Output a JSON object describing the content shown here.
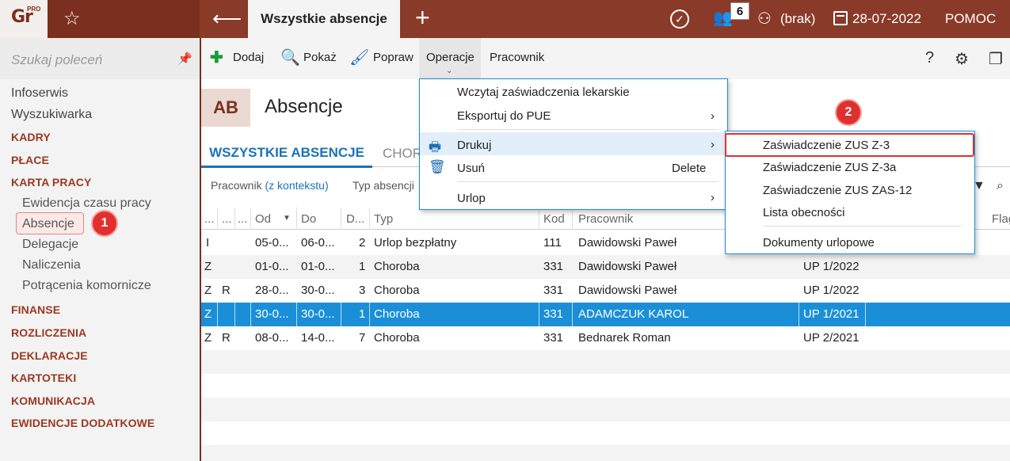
{
  "app": {
    "logo": "Gr",
    "logo_sup": "PRO",
    "active_tab": "Wszystkie absencje",
    "notif_count": "6",
    "user": "(brak)",
    "date": "28-07-2022",
    "help": "POMOC"
  },
  "sidebar": {
    "search_placeholder": "Szukaj poleceń",
    "items": [
      "Infoserwis",
      "Wyszukiwarka"
    ],
    "sections": [
      "KADRY",
      "PŁACE",
      "KARTA PRACY"
    ],
    "karta_sub": [
      "Ewidencja czasu pracy",
      "Absencje",
      "Delegacje",
      "Naliczenia",
      "Potrącenia komornicze"
    ],
    "sections2": [
      "FINANSE",
      "ROZLICZENIA",
      "DEKLARACJE",
      "KARTOTEKI",
      "KOMUNIKACJA",
      "EWIDENCJE DODATKOWE"
    ]
  },
  "toolbar": {
    "add": "Dodaj",
    "show": "Pokaż",
    "edit": "Popraw",
    "operations": "Operacje",
    "employee": "Pracownik",
    "help_icon": "?"
  },
  "header": {
    "badge": "AB",
    "title": "Absencje",
    "tab_all": "WSZYSTKIE ABSENCJE",
    "tab_sick": "CHOR",
    "filter_employee": "Pracownik",
    "filter_context": "(z kontekstu)",
    "filter_type": "Typ absencji"
  },
  "table": {
    "columns": [
      "...",
      "...",
      "...",
      "Od",
      "Do",
      "D...",
      "Typ",
      "Kod",
      "Pracownik",
      "Flag"
    ],
    "rows": [
      [
        "I",
        "",
        "",
        "05-0...",
        "06-0...",
        "2",
        "Urlop bezpłatny",
        "111",
        "Dawidowski Paweł",
        ""
      ],
      [
        "Z",
        "",
        "",
        "01-0...",
        "01-0...",
        "1",
        "Choroba",
        "331",
        "Dawidowski Paweł",
        "UP 1/2022"
      ],
      [
        "Z",
        "R",
        "",
        "28-0...",
        "30-0...",
        "3",
        "Choroba",
        "331",
        "Dawidowski Paweł",
        "UP 1/2022"
      ],
      [
        "Z",
        "",
        "",
        "30-0...",
        "30-0...",
        "1",
        "Choroba",
        "331",
        "ADAMCZUK KAROL",
        "UP 1/2021"
      ],
      [
        "Z",
        "R",
        "",
        "08-0...",
        "14-0...",
        "7",
        "Choroba",
        "331",
        "Bednarek Roman",
        "UP 2/2021"
      ]
    ],
    "selected_row": 3
  },
  "menu": {
    "items": [
      "Wczytaj zaświadczenia lekarskie",
      "Eksportuj do PUE",
      "Drukuj",
      "Usuń",
      "Urlop"
    ],
    "delete_shortcut": "Delete",
    "submenu": [
      "Zaświadczenie ZUS Z-3",
      "Zaświadczenie ZUS Z-3a",
      "Zaświadczenie ZUS ZAS-12",
      "Lista obecności",
      "Dokumenty urlopowe"
    ]
  },
  "annotations": {
    "step1": "1",
    "step2": "2"
  },
  "colors": {
    "brand": "#7b2f1f",
    "accent": "#1a8fd8",
    "highlight": "#e0302e"
  }
}
